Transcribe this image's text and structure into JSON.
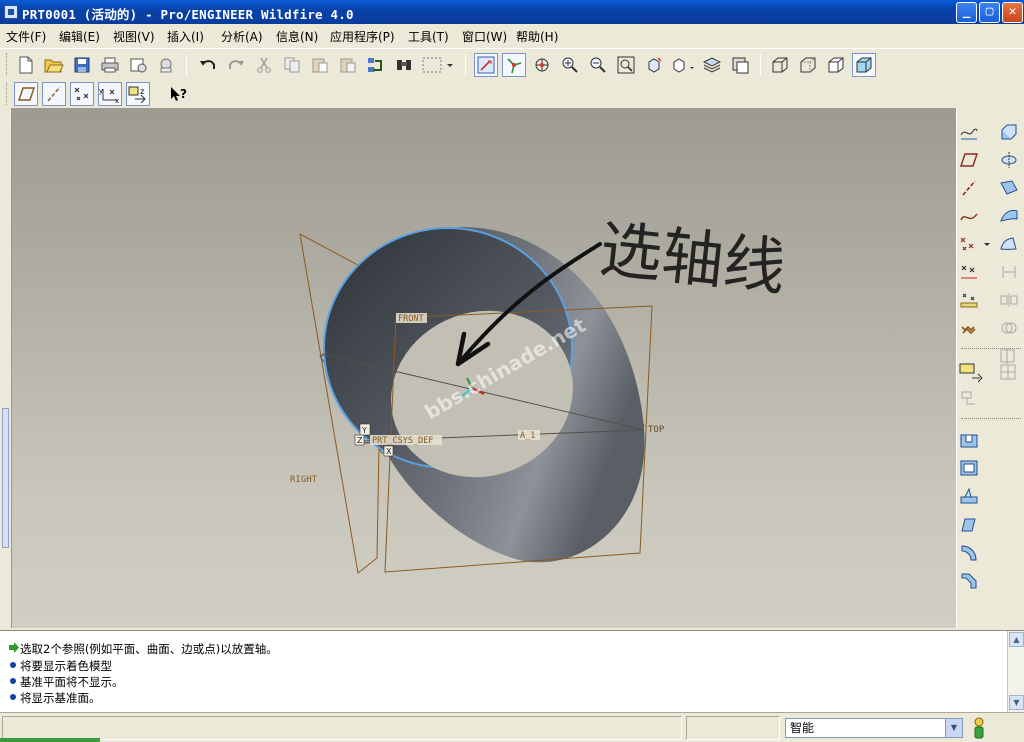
{
  "window": {
    "title": "PRT0001 (活动的) - Pro/ENGINEER Wildfire 4.0",
    "controls": {
      "minimize": "_",
      "maximize": "▢",
      "close": "✕"
    }
  },
  "menu": [
    "文件(F)",
    "编辑(E)",
    "视图(V)",
    "插入(I)",
    "分析(A)",
    "信息(N)",
    "应用程序(P)",
    "工具(T)",
    "窗口(W)",
    "帮助(H)"
  ],
  "toolbar_top": [
    "new-icon",
    "open-icon",
    "save-icon",
    "print-icon",
    "send-icon",
    "send-mail-icon",
    "undo-icon",
    "redo-icon",
    "cut-icon",
    "copy-icon",
    "paste-icon",
    "paste-special-icon",
    "regenerate-icon",
    "find-icon",
    "select-box-icon",
    "repaint-icon",
    "spin-center-icon",
    "orient-mode-icon",
    "zoom-in-icon",
    "zoom-out-icon",
    "refit-icon",
    "reorient-icon",
    "saved-views-icon",
    "layers-icon",
    "view-manager-icon",
    "wireframe-icon",
    "hidden-line-icon",
    "no-hidden-icon",
    "shading-icon"
  ],
  "toolbar_second": [
    "datum-planes-toggle-icon",
    "datum-axes-toggle-icon",
    "datum-points-toggle-icon",
    "csys-toggle-icon",
    "context-help-icon"
  ],
  "viewport": {
    "labels": {
      "front": "FRONT",
      "top": "TOP",
      "right": "RIGHT",
      "csys": "PRT_CSYS_DEF",
      "axis": "A_1",
      "y": "Y",
      "z": "Z",
      "x": "X"
    },
    "annotation_text": "选轴线",
    "watermark": "bbs.chinade.net"
  },
  "right_toolbar": [
    "sketch-icon",
    "plane-icon",
    "axis-icon",
    "curve-icon",
    "point-icon",
    "sketched-point-icon",
    "offset-point-icon",
    "csys-icon",
    "analysis-icon",
    "udf-icon",
    "extrude-icon",
    "revolve-icon",
    "variable-sweep-icon",
    "blend-icon",
    "boundary-blend-icon",
    "style-icon",
    "mirror-icon",
    "merge-icon",
    "trim-icon",
    "pattern-icon",
    "hole-icon",
    "shell-icon",
    "rib-icon",
    "draft-icon",
    "round-icon",
    "chamfer-icon"
  ],
  "messages": [
    {
      "type": "prompt",
      "text": "选取2个参照(例如平面、曲面、边或点)以放置轴。"
    },
    {
      "type": "info",
      "text": "将要显示着色模型"
    },
    {
      "type": "info",
      "text": "基准平面将不显示。"
    },
    {
      "type": "info",
      "text": "将显示基准面。"
    }
  ],
  "status": {
    "filter": "智能"
  }
}
